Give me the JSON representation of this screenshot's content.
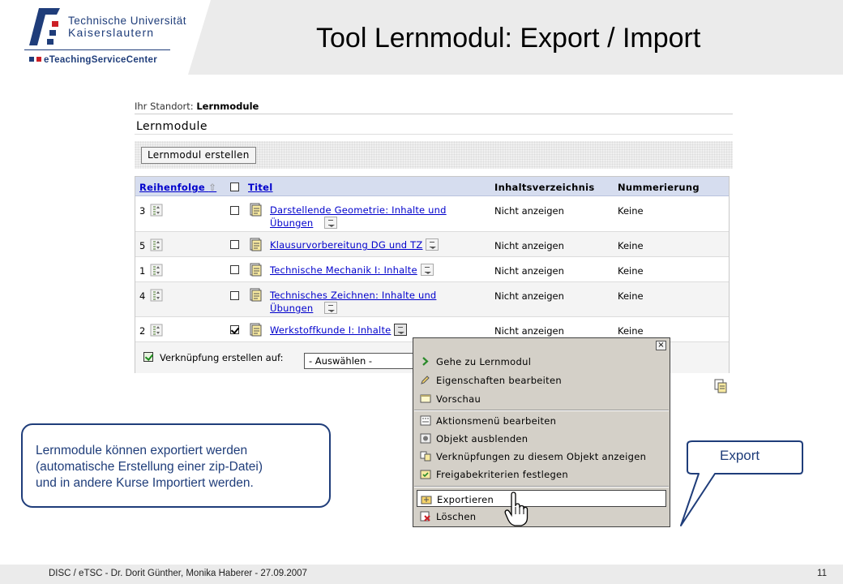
{
  "slide": {
    "title": "Tool Lernmodul: Export / Import",
    "logo": {
      "line1": "Technische Universität",
      "line2": "Kaiserslautern",
      "tagline": "eTeachingServiceCenter"
    },
    "footer": "DISC / eTSC - Dr. Dorit Günther, Monika Haberer  - 27.09.2007",
    "page_number": "11"
  },
  "app": {
    "location_label": "Ihr Standort:",
    "location_value": "Lernmodule",
    "page_heading": "Lernmodule",
    "create_button": "Lernmodul erstellen",
    "columns": {
      "order": "Reihenfolge",
      "title": "Titel",
      "toc": "Inhaltsverzeichnis",
      "numbering": "Nummerierung"
    },
    "rows": [
      {
        "order": "3",
        "title_1": "Darstellende Geometrie: Inhalte und",
        "title_2": "Übungen",
        "toc": "Nicht anzeigen",
        "numbering": "Keine",
        "checked": false
      },
      {
        "order": "5",
        "title_1": "Klausurvorbereitung DG und TZ",
        "title_2": "",
        "toc": "Nicht anzeigen",
        "numbering": "Keine",
        "checked": false
      },
      {
        "order": "1",
        "title_1": "Technische Mechanik I: Inhalte",
        "title_2": "",
        "toc": "Nicht anzeigen",
        "numbering": "Keine",
        "checked": false
      },
      {
        "order": "4",
        "title_1": "Technisches Zeichnen: Inhalte und",
        "title_2": "Übungen",
        "toc": "Nicht anzeigen",
        "numbering": "Keine",
        "checked": false
      },
      {
        "order": "2",
        "title_1": "Werkstoffkunde I: Inhalte",
        "title_2": "",
        "toc": "Nicht anzeigen",
        "numbering": "Keine",
        "checked": true
      }
    ],
    "link_label": "Verknüpfung erstellen auf:",
    "link_select": "- Auswählen -"
  },
  "menu": {
    "close": "×",
    "items": [
      {
        "label": "Gehe zu Lernmodul",
        "icon": "arrow-right-icon"
      },
      {
        "label": "Eigenschaften bearbeiten",
        "icon": "pencil-icon"
      },
      {
        "label": "Vorschau",
        "icon": "window-icon"
      },
      {
        "label": "Aktionsmenü bearbeiten",
        "icon": "menu-edit-icon"
      },
      {
        "label": "Objekt ausblenden",
        "icon": "hide-icon"
      },
      {
        "label": "Verknüpfungen zu diesem Objekt anzeigen",
        "icon": "links-icon"
      },
      {
        "label": "Freigabekriterien festlegen",
        "icon": "release-icon"
      },
      {
        "label": "Exportieren",
        "icon": "export-icon"
      },
      {
        "label": "Löschen",
        "icon": "delete-icon"
      }
    ],
    "selected": "Exportieren"
  },
  "callouts": {
    "left": "Lernmodule können exportiert werden\n(automatische Erstellung einer zip-Datei)\nund in andere Kurse Importiert werden.",
    "right": "Export"
  },
  "colors": {
    "brand_blue": "#1f3d7a",
    "brand_red": "#cc1f26",
    "link": "#0000cc",
    "table_header": "#d6ddef",
    "menu_bg": "#d4d0c8"
  }
}
